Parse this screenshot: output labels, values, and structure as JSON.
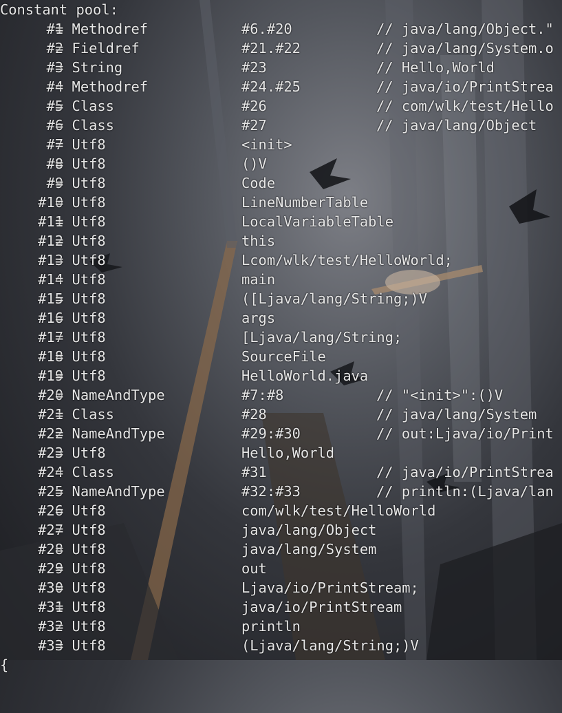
{
  "header": "Constant pool:",
  "entries": [
    {
      "idx": "#1",
      "type": "Methodref",
      "value": "#6.#20",
      "comment": "// java/lang/Object.\""
    },
    {
      "idx": "#2",
      "type": "Fieldref",
      "value": "#21.#22",
      "comment": "// java/lang/System.o"
    },
    {
      "idx": "#3",
      "type": "String",
      "value": "#23",
      "comment": "// Hello,World"
    },
    {
      "idx": "#4",
      "type": "Methodref",
      "value": "#24.#25",
      "comment": "// java/io/PrintStrea"
    },
    {
      "idx": "#5",
      "type": "Class",
      "value": "#26",
      "comment": "// com/wlk/test/Hello"
    },
    {
      "idx": "#6",
      "type": "Class",
      "value": "#27",
      "comment": "// java/lang/Object"
    },
    {
      "idx": "#7",
      "type": "Utf8",
      "value": "<init>",
      "comment": ""
    },
    {
      "idx": "#8",
      "type": "Utf8",
      "value": "()V",
      "comment": ""
    },
    {
      "idx": "#9",
      "type": "Utf8",
      "value": "Code",
      "comment": ""
    },
    {
      "idx": "#10",
      "type": "Utf8",
      "value": "LineNumberTable",
      "comment": ""
    },
    {
      "idx": "#11",
      "type": "Utf8",
      "value": "LocalVariableTable",
      "comment": ""
    },
    {
      "idx": "#12",
      "type": "Utf8",
      "value": "this",
      "comment": ""
    },
    {
      "idx": "#13",
      "type": "Utf8",
      "value": "Lcom/wlk/test/HelloWorld;",
      "comment": ""
    },
    {
      "idx": "#14",
      "type": "Utf8",
      "value": "main",
      "comment": ""
    },
    {
      "idx": "#15",
      "type": "Utf8",
      "value": "([Ljava/lang/String;)V",
      "comment": ""
    },
    {
      "idx": "#16",
      "type": "Utf8",
      "value": "args",
      "comment": ""
    },
    {
      "idx": "#17",
      "type": "Utf8",
      "value": "[Ljava/lang/String;",
      "comment": ""
    },
    {
      "idx": "#18",
      "type": "Utf8",
      "value": "SourceFile",
      "comment": ""
    },
    {
      "idx": "#19",
      "type": "Utf8",
      "value": "HelloWorld.java",
      "comment": ""
    },
    {
      "idx": "#20",
      "type": "NameAndType",
      "value": "#7:#8",
      "comment": "// \"<init>\":()V"
    },
    {
      "idx": "#21",
      "type": "Class",
      "value": "#28",
      "comment": "// java/lang/System"
    },
    {
      "idx": "#22",
      "type": "NameAndType",
      "value": "#29:#30",
      "comment": "// out:Ljava/io/Print"
    },
    {
      "idx": "#23",
      "type": "Utf8",
      "value": "Hello,World",
      "comment": ""
    },
    {
      "idx": "#24",
      "type": "Class",
      "value": "#31",
      "comment": "// java/io/PrintStrea"
    },
    {
      "idx": "#25",
      "type": "NameAndType",
      "value": "#32:#33",
      "comment": "// println:(Ljava/lan"
    },
    {
      "idx": "#26",
      "type": "Utf8",
      "value": "com/wlk/test/HelloWorld",
      "comment": ""
    },
    {
      "idx": "#27",
      "type": "Utf8",
      "value": "java/lang/Object",
      "comment": ""
    },
    {
      "idx": "#28",
      "type": "Utf8",
      "value": "java/lang/System",
      "comment": ""
    },
    {
      "idx": "#29",
      "type": "Utf8",
      "value": "out",
      "comment": ""
    },
    {
      "idx": "#30",
      "type": "Utf8",
      "value": "Ljava/io/PrintStream;",
      "comment": ""
    },
    {
      "idx": "#31",
      "type": "Utf8",
      "value": "java/io/PrintStream",
      "comment": ""
    },
    {
      "idx": "#32",
      "type": "Utf8",
      "value": "println",
      "comment": ""
    },
    {
      "idx": "#33",
      "type": "Utf8",
      "value": "(Ljava/lang/String;)V",
      "comment": ""
    }
  ],
  "trailing": "{",
  "colors": {
    "text": "#e6e6e6",
    "background": "#34363c"
  }
}
